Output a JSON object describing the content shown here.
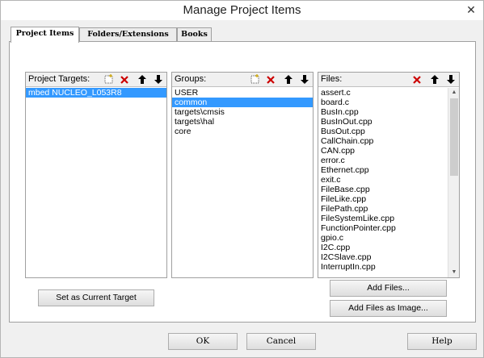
{
  "window": {
    "title": "Manage Project Items",
    "close_glyph": "✕"
  },
  "tabs": [
    {
      "label": "Project Items",
      "active": true
    },
    {
      "label": "Folders/Extensions",
      "active": false
    },
    {
      "label": "Books",
      "active": false
    }
  ],
  "targets": {
    "label": "Project Targets:",
    "items": [
      {
        "label": "mbed NUCLEO_L053R8",
        "selected": true
      }
    ]
  },
  "groups": {
    "label": "Groups:",
    "items": [
      {
        "label": "USER",
        "selected": false
      },
      {
        "label": "common",
        "selected": true
      },
      {
        "label": "targets\\cmsis",
        "selected": false
      },
      {
        "label": "targets\\hal",
        "selected": false
      },
      {
        "label": "core",
        "selected": false
      }
    ]
  },
  "files": {
    "label": "Files:",
    "items": [
      "assert.c",
      "board.c",
      "BusIn.cpp",
      "BusInOut.cpp",
      "BusOut.cpp",
      "CallChain.cpp",
      "CAN.cpp",
      "error.c",
      "Ethernet.cpp",
      "exit.c",
      "FileBase.cpp",
      "FileLike.cpp",
      "FilePath.cpp",
      "FileSystemLike.cpp",
      "FunctionPointer.cpp",
      "gpio.c",
      "I2C.cpp",
      "I2CSlave.cpp",
      "InterruptIn.cpp"
    ]
  },
  "buttons": {
    "set_current_target": "Set as Current Target",
    "add_files": "Add Files...",
    "add_files_as_image": "Add Files as Image...",
    "ok": "OK",
    "cancel": "Cancel",
    "help": "Help"
  },
  "colors": {
    "selection": "#3399ff",
    "delete_icon": "#cc0000"
  },
  "icons": [
    "new-item-icon",
    "delete-icon",
    "move-up-icon",
    "move-down-icon",
    "scroll-up-arrow-icon",
    "scroll-down-arrow-icon"
  ]
}
